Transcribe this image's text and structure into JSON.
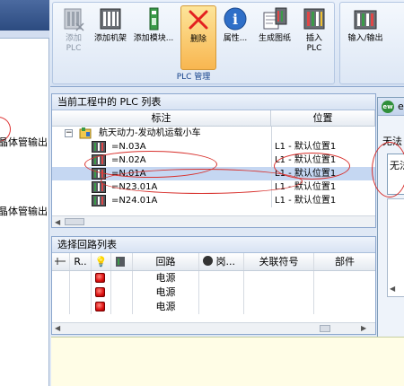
{
  "left_panel": {
    "labels": [
      "晶体管输出",
      "晶体管输出"
    ]
  },
  "ribbon": {
    "group_label": "PLC 管理",
    "buttons": [
      {
        "label": "添加\nPLC",
        "icon": "add-plc-icon",
        "enabled": false
      },
      {
        "label": "添加机架",
        "icon": "add-rack-icon",
        "enabled": true
      },
      {
        "label": "添加模块...",
        "icon": "add-module-icon",
        "enabled": true
      },
      {
        "label": "删除",
        "icon": "delete-icon",
        "enabled": true
      },
      {
        "label": "属性...",
        "icon": "properties-icon",
        "enabled": true
      },
      {
        "label": "生成图纸",
        "icon": "generate-drawing-icon",
        "enabled": true
      },
      {
        "label": "插入\nPLC",
        "icon": "insert-plc-icon",
        "enabled": true
      }
    ],
    "right_buttons": [
      {
        "label": "输入/输出",
        "icon": "io-icon"
      }
    ]
  },
  "plc_panel": {
    "title": "当前工程中的 PLC 列表",
    "columns": [
      "标注",
      "位置"
    ],
    "root": {
      "name": "航天动力-发动机运载小车",
      "expander": "−"
    },
    "rows": [
      {
        "name": "=N.03A",
        "location": "L1 - 默认位置1",
        "selected": false
      },
      {
        "name": "=N.02A",
        "location": "L1 - 默认位置1",
        "selected": false
      },
      {
        "name": "=N.01A",
        "location": "L1 - 默认位置1",
        "selected": true
      },
      {
        "name": "=N23.01A",
        "location": "L1 - 默认位置1",
        "selected": false
      },
      {
        "name": "=N24.01A",
        "location": "L1 - 默认位置1",
        "selected": false
      }
    ]
  },
  "loop_panel": {
    "title": "选择回路列表",
    "columns": [
      "",
      "R..",
      "",
      "",
      "回路",
      "岗...",
      "关联符号",
      "部件"
    ],
    "rows": [
      {
        "circuit": "电源"
      },
      {
        "circuit": "电源"
      },
      {
        "circuit": "电源"
      }
    ]
  },
  "dialog": {
    "title_char": "e",
    "logo_text": "ew",
    "line1": "无法",
    "box_text": "无法"
  },
  "colors": {
    "accent": "#15428b",
    "selected_row": "#c5d7f2",
    "annotation_red": "#d8312d"
  }
}
